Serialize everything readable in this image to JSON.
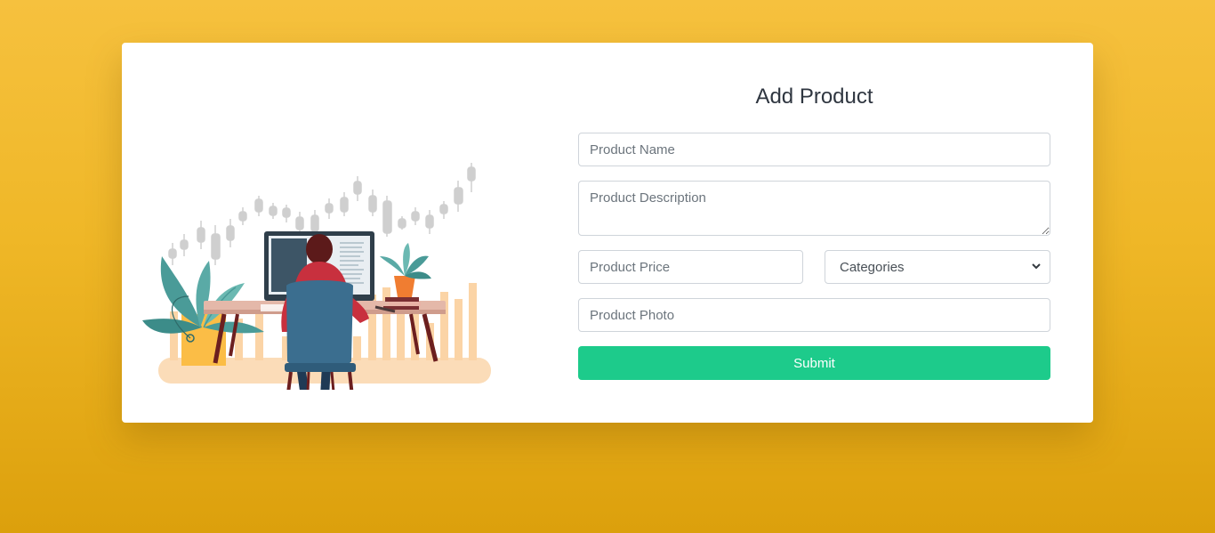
{
  "form": {
    "title": "Add Product",
    "name_placeholder": "Product Name",
    "description_placeholder": "Product Description",
    "price_placeholder": "Product Price",
    "category_selected": "Categories",
    "photo_placeholder": "Product Photo",
    "submit_label": "Submit"
  },
  "colors": {
    "background_top": "#f6c13e",
    "background_bottom": "#dca00c",
    "submit_button": "#1dcb8b",
    "card": "#ffffff"
  },
  "illustration": {
    "subject": "person-at-desk-with-trading-chart"
  }
}
